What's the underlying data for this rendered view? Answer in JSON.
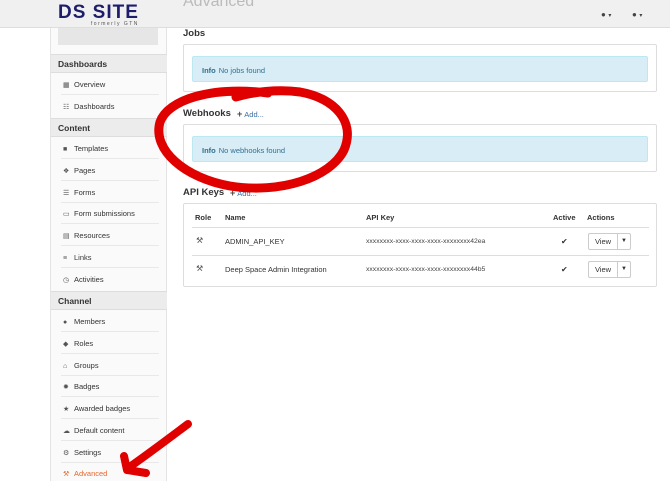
{
  "header": {
    "logo": "DS SITE",
    "logo_sub": "formerly GTN",
    "page_title": "Advanced",
    "help_menu": "❓ ▾",
    "user_menu": "👤 ▾"
  },
  "sidebar": {
    "sections": [
      {
        "label": "Dashboards",
        "items": [
          {
            "label": "Overview",
            "icon": "grid-icon",
            "glyph": "▦"
          },
          {
            "label": "Dashboards",
            "icon": "dashboard-icon",
            "glyph": "☷"
          }
        ]
      },
      {
        "label": "Content",
        "items": [
          {
            "label": "Templates",
            "icon": "file-icon",
            "glyph": "■"
          },
          {
            "label": "Pages",
            "icon": "pages-icon",
            "glyph": "❖"
          },
          {
            "label": "Forms",
            "icon": "form-icon",
            "glyph": "☰"
          },
          {
            "label": "Form submissions",
            "icon": "inbox-icon",
            "glyph": "▭"
          },
          {
            "label": "Resources",
            "icon": "resources-icon",
            "glyph": "▤"
          },
          {
            "label": "Links",
            "icon": "links-icon",
            "glyph": "≡"
          },
          {
            "label": "Activities",
            "icon": "activities-icon",
            "glyph": "◷"
          }
        ]
      },
      {
        "label": "Channel",
        "items": [
          {
            "label": "Members",
            "icon": "user-icon",
            "glyph": "●"
          },
          {
            "label": "Roles",
            "icon": "tag-icon",
            "glyph": "◆"
          },
          {
            "label": "Groups",
            "icon": "home-icon",
            "glyph": "⌂"
          },
          {
            "label": "Badges",
            "icon": "badge-icon",
            "glyph": "✹"
          },
          {
            "label": "Awarded badges",
            "icon": "star-icon",
            "glyph": "★"
          },
          {
            "label": "Default content",
            "icon": "cloud-icon",
            "glyph": "☁"
          },
          {
            "label": "Settings",
            "icon": "gear-icon",
            "glyph": "⚙"
          },
          {
            "label": "Advanced",
            "icon": "wrench-icon",
            "glyph": "⚒",
            "active": true
          }
        ]
      }
    ]
  },
  "jobs": {
    "title": "Jobs",
    "info_label": "Info",
    "info_text": "No jobs found"
  },
  "webhooks": {
    "title": "Webhooks",
    "add_label": "Add...",
    "info_label": "Info",
    "info_text": "No webhooks found"
  },
  "api_keys": {
    "title": "API Keys",
    "add_label": "Add...",
    "columns": {
      "role": "Role",
      "name": "Name",
      "api_key": "API Key",
      "active": "Active",
      "actions": "Actions"
    },
    "rows": [
      {
        "name": "ADMIN_API_KEY",
        "api_key": "xxxxxxxx-xxxx-xxxx-xxxx-xxxxxxxx42ea",
        "active": "✔",
        "view_label": "View"
      },
      {
        "name": "Deep Space Admin Integration",
        "api_key": "xxxxxxxx-xxxx-xxxx-xxxx-xxxxxxxx44b5",
        "active": "✔",
        "view_label": "View"
      }
    ]
  },
  "colors": {
    "accent": "#e8672a",
    "link": "#3a6ea5",
    "info_bg": "#d9edf7",
    "annotation": "#e00000"
  }
}
